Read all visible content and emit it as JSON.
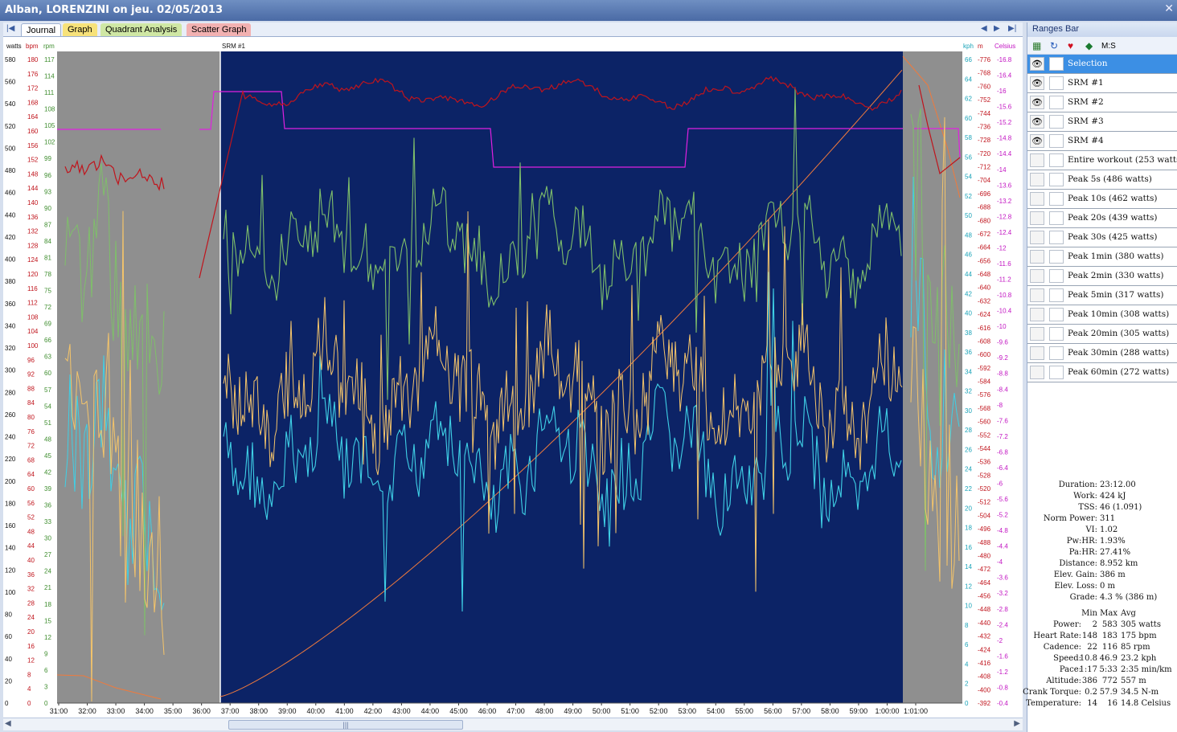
{
  "window": {
    "title": "Alban, LORENZINI on jeu. 02/05/2013",
    "close_glyph": "✕"
  },
  "tabs": [
    {
      "label": "Journal"
    },
    {
      "label": "Graph"
    },
    {
      "label": "Quadrant Analysis"
    },
    {
      "label": "Scatter Graph"
    }
  ],
  "chart": {
    "marker_label": "SRM #1",
    "axes": {
      "watts": {
        "unit": "watts",
        "ticks": [
          "0",
          "20",
          "40",
          "60",
          "80",
          "100",
          "120",
          "140",
          "160",
          "180",
          "200",
          "220",
          "240",
          "260",
          "280",
          "300",
          "320",
          "340",
          "360",
          "380",
          "400",
          "420",
          "440",
          "460",
          "480",
          "500",
          "520",
          "540",
          "560",
          "580"
        ]
      },
      "bpm": {
        "unit": "bpm",
        "ticks": [
          "0",
          "4",
          "8",
          "12",
          "16",
          "20",
          "24",
          "28",
          "32",
          "36",
          "40",
          "44",
          "48",
          "52",
          "56",
          "60",
          "64",
          "68",
          "72",
          "76",
          "80",
          "84",
          "88",
          "92",
          "96",
          "100",
          "104",
          "108",
          "112",
          "116",
          "120",
          "124",
          "128",
          "132",
          "136",
          "140",
          "144",
          "148",
          "152",
          "156",
          "160",
          "164",
          "168",
          "172",
          "176",
          "180"
        ]
      },
      "rpm": {
        "unit": "rpm",
        "ticks": [
          "0",
          "3",
          "6",
          "9",
          "12",
          "15",
          "18",
          "21",
          "24",
          "27",
          "30",
          "33",
          "36",
          "39",
          "42",
          "45",
          "48",
          "51",
          "54",
          "57",
          "60",
          "63",
          "66",
          "69",
          "72",
          "75",
          "78",
          "81",
          "84",
          "87",
          "90",
          "93",
          "96",
          "99",
          "102",
          "105",
          "108",
          "111",
          "114",
          "117"
        ]
      },
      "kph": {
        "unit": "kph",
        "ticks": [
          "0",
          "2",
          "4",
          "6",
          "8",
          "10",
          "12",
          "14",
          "16",
          "18",
          "20",
          "22",
          "24",
          "26",
          "28",
          "30",
          "32",
          "34",
          "36",
          "38",
          "40",
          "42",
          "44",
          "46",
          "48",
          "50",
          "52",
          "54",
          "56",
          "58",
          "60",
          "62",
          "64",
          "66"
        ]
      },
      "m": {
        "unit": "m",
        "ticks": [
          "-392",
          "-400",
          "-408",
          "-416",
          "-424",
          "-432",
          "-440",
          "-448",
          "-456",
          "-464",
          "-472",
          "-480",
          "-488",
          "-496",
          "-504",
          "-512",
          "-520",
          "-528",
          "-536",
          "-544",
          "-552",
          "-560",
          "-568",
          "-576",
          "-584",
          "-592",
          "-600",
          "-608",
          "-616",
          "-624",
          "-632",
          "-640",
          "-648",
          "-656",
          "-664",
          "-672",
          "-680",
          "-688",
          "-696",
          "-704",
          "-712",
          "-720",
          "-728",
          "-736",
          "-744",
          "-752",
          "-760",
          "-768",
          "-776"
        ]
      },
      "celsius": {
        "unit": "Celsius",
        "ticks": [
          "-0.4",
          "-0.8",
          "-1.2",
          "-1.6",
          "-2",
          "-2.4",
          "-2.8",
          "-3.2",
          "-3.6",
          "-4",
          "-4.4",
          "-4.8",
          "-5.2",
          "-5.6",
          "-6",
          "-6.4",
          "-6.8",
          "-7.2",
          "-7.6",
          "-8",
          "-8.4",
          "-8.8",
          "-9.2",
          "-9.6",
          "-10",
          "-10.4",
          "-10.8",
          "-11.2",
          "-11.6",
          "-12",
          "-12.4",
          "-12.8",
          "-13.2",
          "-13.6",
          "-14",
          "-14.4",
          "-14.8",
          "-15.2",
          "-15.6",
          "-16",
          "-16.4",
          "-16.8"
        ]
      }
    },
    "time_ticks": [
      "31:00",
      "32:00",
      "33:00",
      "34:00",
      "35:00",
      "36:00",
      "37:00",
      "38:00",
      "39:00",
      "40:00",
      "41:00",
      "42:00",
      "43:00",
      "44:00",
      "45:00",
      "46:00",
      "47:00",
      "48:00",
      "49:00",
      "50:00",
      "51:00",
      "52:00",
      "53:00",
      "54:00",
      "55:00",
      "56:00",
      "57:00",
      "58:00",
      "59:00",
      "1:00:00",
      "1:01:00"
    ],
    "colors": {
      "selection_bg": "#0c2366",
      "outside_bg": "#8f8f8f",
      "power": "#f4c46a",
      "heart_rate": "#c0141c",
      "cadence": "#7fbf6a",
      "speed": "#3fd0e6",
      "altitude": "#f07a3c",
      "markers": "#e020e0"
    }
  },
  "ranges_bar": {
    "title": "Ranges Bar",
    "tools": {
      "ms_label": "M:S"
    },
    "items": [
      {
        "label": "Selection",
        "eye": "👁",
        "selected": true
      },
      {
        "label": "SRM #1",
        "eye": "👁"
      },
      {
        "label": "SRM #2",
        "eye": "👁"
      },
      {
        "label": "SRM #3",
        "eye": "👁"
      },
      {
        "label": "SRM #4",
        "eye": "👁"
      },
      {
        "label": "Entire workout (253 watts)",
        "eye": ""
      },
      {
        "label": "Peak 5s (486 watts)",
        "eye": ""
      },
      {
        "label": "Peak 10s (462 watts)",
        "eye": ""
      },
      {
        "label": "Peak 20s (439 watts)",
        "eye": ""
      },
      {
        "label": "Peak 30s (425 watts)",
        "eye": ""
      },
      {
        "label": "Peak 1min (380 watts)",
        "eye": ""
      },
      {
        "label": "Peak 2min (330 watts)",
        "eye": ""
      },
      {
        "label": "Peak 5min (317 watts)",
        "eye": ""
      },
      {
        "label": "Peak 10min (308 watts)",
        "eye": ""
      },
      {
        "label": "Peak 20min (305 watts)",
        "eye": ""
      },
      {
        "label": "Peak 30min (288 watts)",
        "eye": ""
      },
      {
        "label": "Peak 60min (272 watts)",
        "eye": ""
      }
    ]
  },
  "summary": [
    {
      "k": "Duration:",
      "v": "23:12.00"
    },
    {
      "k": "Work:",
      "v": "424 kJ"
    },
    {
      "k": "TSS:",
      "v": "46 (1.091)"
    },
    {
      "k": "Norm Power:",
      "v": "311"
    },
    {
      "k": "VI:",
      "v": "1.02"
    },
    {
      "k": "Pw:HR:",
      "v": "1.93%"
    },
    {
      "k": "Pa:HR:",
      "v": "27.41%"
    },
    {
      "k": "Distance:",
      "v": "8.952 km"
    },
    {
      "k": "Elev. Gain:",
      "v": "386 m"
    },
    {
      "k": "Elev. Loss:",
      "v": "0 m"
    },
    {
      "k": "Grade:",
      "v": "4.3 % (386 m)"
    }
  ],
  "stats_table": {
    "headers": [
      "Min",
      "Max",
      "Avg"
    ],
    "rows": [
      {
        "k": "Power:",
        "min": "2",
        "max": "583",
        "avg": "305 watts"
      },
      {
        "k": "Heart Rate:",
        "min": "148",
        "max": "183",
        "avg": "175 bpm"
      },
      {
        "k": "Cadence:",
        "min": "22",
        "max": "116",
        "avg": "85 rpm"
      },
      {
        "k": "Speed:",
        "min": "10.8",
        "max": "46.9",
        "avg": "23.2 kph"
      },
      {
        "k": "Pace:",
        "min": "1:17",
        "max": "5:33",
        "avg": "2:35 min/km"
      },
      {
        "k": "Altitude:",
        "min": "386",
        "max": "772",
        "avg": "557 m"
      },
      {
        "k": "Crank Torque:",
        "min": "0.2",
        "max": "57.9",
        "avg": "34.5 N-m"
      },
      {
        "k": "Temperature:",
        "min": "14",
        "max": "16",
        "avg": "14.8 Celsius"
      }
    ]
  }
}
